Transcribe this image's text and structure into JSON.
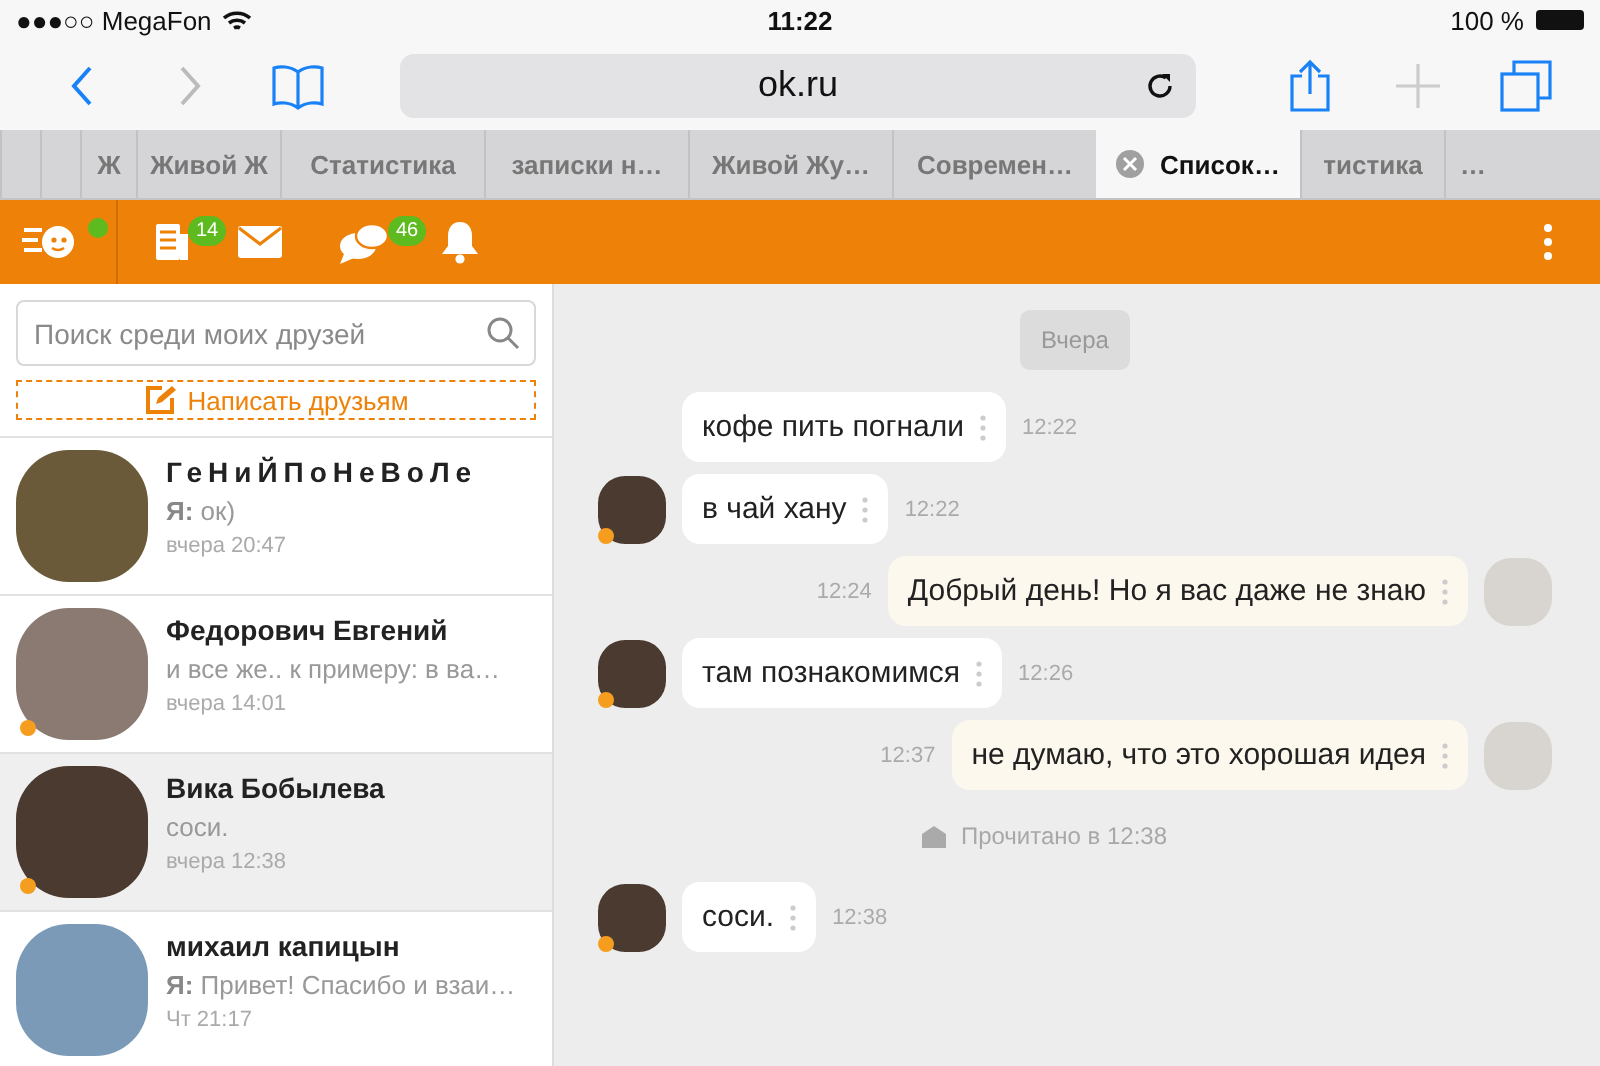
{
  "status_bar": {
    "carrier": "●●●○○ MegaFon",
    "time": "11:22",
    "battery": "100 %"
  },
  "browser": {
    "address": "ok.ru"
  },
  "tabs": [
    {
      "selected": false
    },
    {
      "selected": false
    },
    {
      "title": "Ж",
      "selected": false
    },
    {
      "title": "Живой Ж",
      "selected": false
    },
    {
      "title": "Статистика",
      "selected": false
    },
    {
      "title": "записки н…",
      "selected": false
    },
    {
      "title": "Живой Жу…",
      "selected": false
    },
    {
      "title": "Современ…",
      "selected": false
    },
    {
      "title": "Список…",
      "selected": true
    },
    {
      "title": "тистика",
      "selected": false
    },
    {
      "title": "…",
      "selected": false
    }
  ],
  "app_bar": {
    "logo_online": true,
    "news_badge": "14",
    "discussions_badge": "46"
  },
  "sidebar": {
    "search_placeholder": "Поиск среди моих друзей",
    "write_button": "Написать друзьям",
    "contacts": [
      {
        "name": "ГеНиЙПоНеВоЛе",
        "preview": "**Я:** ок)",
        "time": "вчера 20:47",
        "online": false,
        "selected": false
      },
      {
        "name": "Федорович Евгений",
        "preview": "и все же.. к примеру: в ва…",
        "time": "вчера 14:01",
        "online": true,
        "selected": false
      },
      {
        "name": "Вика Бобылева",
        "preview": "соси.",
        "time": "вчера 12:38",
        "online": true,
        "selected": true
      },
      {
        "name": "михаил капицын",
        "preview": "**Я:** Привет! Спасибо и взаи…",
        "time": "Чт 21:17",
        "online": false,
        "selected": false
      }
    ]
  },
  "chat": {
    "items": [
      {
        "kind": "date",
        "text": "Вчера"
      },
      {
        "kind": "incoming",
        "text": "кофе пить погнали",
        "time": "12:22",
        "avatar": false
      },
      {
        "kind": "incoming",
        "text": "в чай хану",
        "time": "12:22",
        "avatar": true,
        "online": true
      },
      {
        "kind": "outgoing",
        "text": "Добрый день! Но я вас даже не знаю",
        "time": "12:24",
        "avatar": true
      },
      {
        "kind": "incoming",
        "text": "там познакомимся",
        "time": "12:26",
        "avatar": true,
        "online": true
      },
      {
        "kind": "outgoing",
        "text": "не думаю, что это хорошая идея",
        "time": "12:37",
        "avatar": true
      },
      {
        "kind": "read",
        "text": "Прочитано в 12:38"
      },
      {
        "kind": "incoming",
        "text": "соси.",
        "time": "12:38",
        "avatar": true,
        "online": true
      }
    ]
  }
}
